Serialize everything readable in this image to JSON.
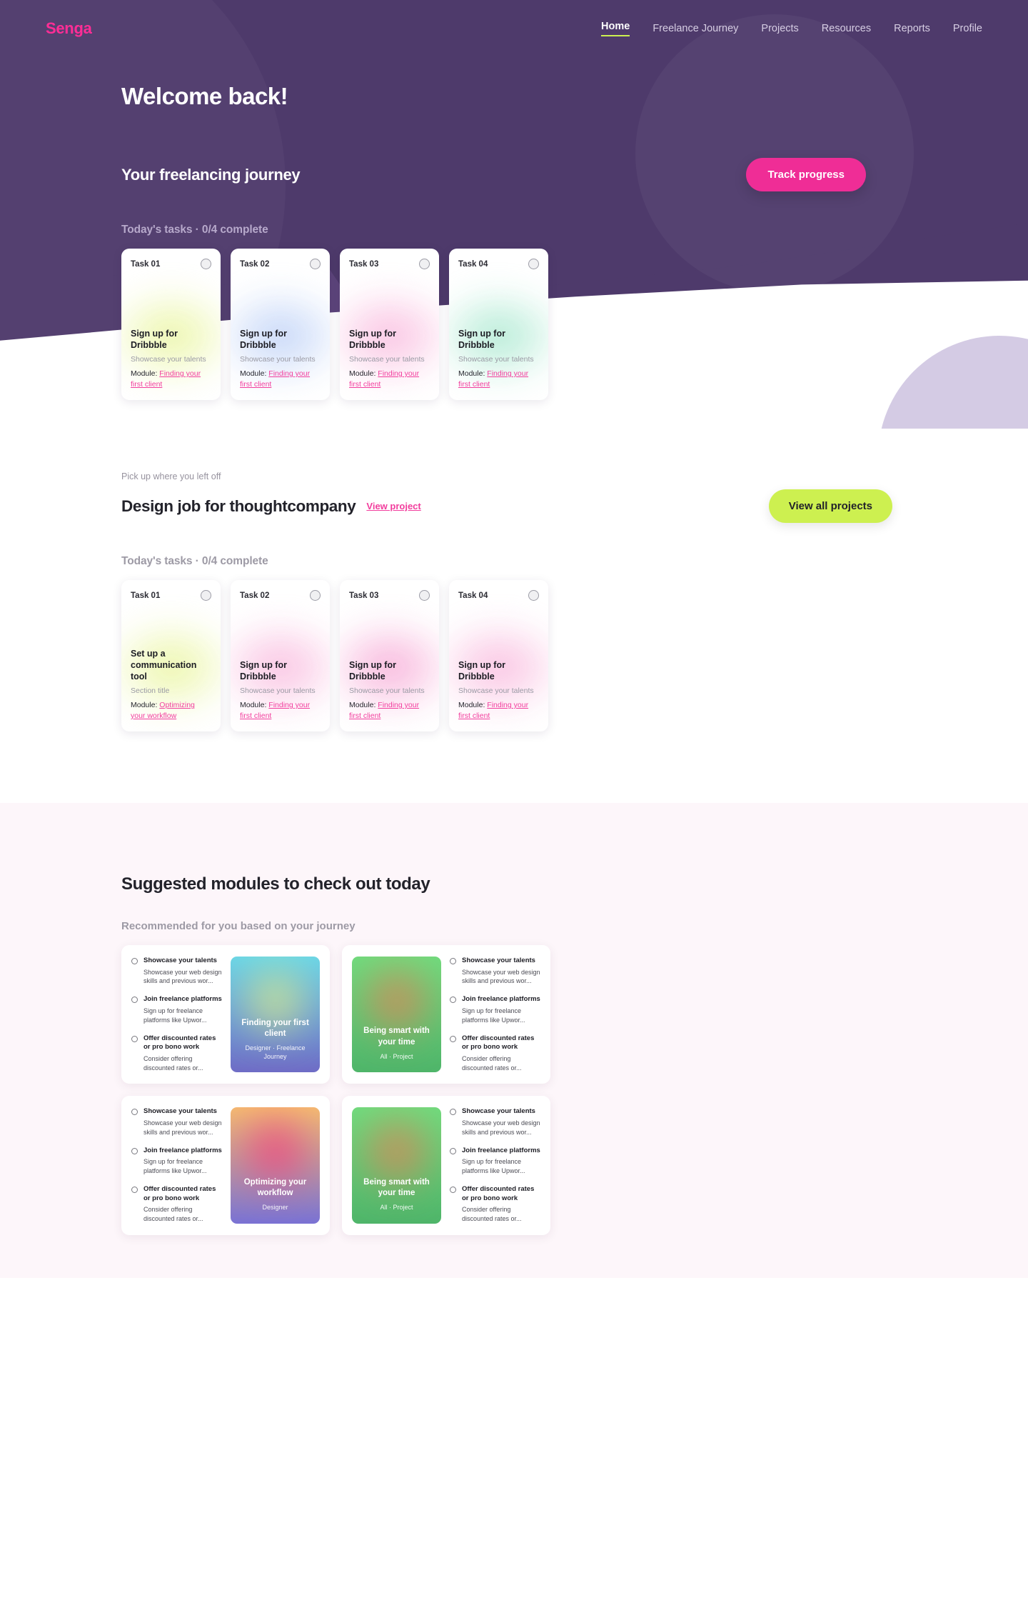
{
  "brand": {
    "logo": "Senga",
    "accent_pink": "#ef2d96",
    "accent_lime": "#cdf050",
    "hero_purple": "#4e3a6b"
  },
  "nav": {
    "items": [
      {
        "label": "Home",
        "active": true
      },
      {
        "label": "Freelance Journey",
        "active": false
      },
      {
        "label": "Projects",
        "active": false
      },
      {
        "label": "Resources",
        "active": false
      },
      {
        "label": "Reports",
        "active": false
      },
      {
        "label": "Profile",
        "active": false
      }
    ]
  },
  "hero": {
    "welcome": "Welcome back!",
    "journey_title": "Your freelancing journey",
    "track_button": "Track progress",
    "tasks_label": "Today's tasks · 0/4 complete"
  },
  "hero_tasks": [
    {
      "num": "Task 01",
      "title": "Sign up for Dribbble",
      "sub": "Showcase your talents",
      "module_prefix": "Module: ",
      "module_link": "Finding your first client",
      "glow": "#e9f59c"
    },
    {
      "num": "Task 02",
      "title": "Sign up for Dribbble",
      "sub": "Showcase your talents",
      "module_prefix": "Module: ",
      "module_link": "Finding your first client",
      "glow": "#bcd0f7"
    },
    {
      "num": "Task 03",
      "title": "Sign up for Dribbble",
      "sub": "Showcase your talents",
      "module_prefix": "Module: ",
      "module_link": "Finding your first client",
      "glow": "#f9b8dd"
    },
    {
      "num": "Task 04",
      "title": "Sign up for Dribbble",
      "sub": "Showcase your talents",
      "module_prefix": "Module: ",
      "module_link": "Finding your first client",
      "glow": "#a8e8cf"
    }
  ],
  "pickup": {
    "kicker": "Pick up where you left off",
    "title": "Design job for thoughtcompany",
    "view_project": "View project",
    "view_all_button": "View all projects",
    "tasks_label": "Today's tasks · 0/4 complete"
  },
  "pickup_tasks": [
    {
      "num": "Task 01",
      "title": "Set up a communication tool",
      "sub": "Section title",
      "module_prefix": "Module: ",
      "module_link": "Optimizing your workflow",
      "glow": "#e9f59c"
    },
    {
      "num": "Task 02",
      "title": "Sign up for Dribbble",
      "sub": "Showcase your talents",
      "module_prefix": "Module: ",
      "module_link": "Finding your first client",
      "glow": "#f9b8dd"
    },
    {
      "num": "Task 03",
      "title": "Sign up for Dribbble",
      "sub": "Showcase your talents",
      "module_prefix": "Module: ",
      "module_link": "Finding your first client",
      "glow": "#f7a9d6"
    },
    {
      "num": "Task 04",
      "title": "Sign up for Dribbble",
      "sub": "Showcase your talents",
      "module_prefix": "Module: ",
      "module_link": "Finding your first client",
      "glow": "#f9b8dd"
    }
  ],
  "suggested": {
    "title": "Suggested modules to check out today",
    "subtitle": "Recommended for you based on your journey"
  },
  "module_items": [
    {
      "title": "Showcase your talents",
      "desc": "Showcase your web design skills and previous wor..."
    },
    {
      "title": "Join freelance platforms",
      "desc": "Sign up for freelance platforms like Upwor..."
    },
    {
      "title": "Offer discounted rates or pro bono work",
      "desc": "Consider offering discounted rates or..."
    }
  ],
  "module_cards": [
    {
      "thumb_title": "Finding your first client",
      "thumb_meta": "Designer · Freelance Journey",
      "thumb_top": "#6ad6e8",
      "thumb_bottom": "#6f6cc6",
      "thumb_glow": "#d8e88a",
      "thumb_side": "right"
    },
    {
      "thumb_title": "Being smart with your time",
      "thumb_meta": "All · Project",
      "thumb_top": "#6fdc7e",
      "thumb_bottom": "#4fb56a",
      "thumb_glow": "#df8256",
      "thumb_side": "left"
    },
    {
      "thumb_title": "Optimizing your workflow",
      "thumb_meta": "Designer",
      "thumb_top": "#f5bb70",
      "thumb_bottom": "#7a72d4",
      "thumb_glow": "#f0407e",
      "thumb_side": "right"
    },
    {
      "thumb_title": "Being smart with your time",
      "thumb_meta": "All · Project",
      "thumb_top": "#6fdc7e",
      "thumb_bottom": "#4fb56a",
      "thumb_glow": "#df8256",
      "thumb_side": "left"
    }
  ]
}
